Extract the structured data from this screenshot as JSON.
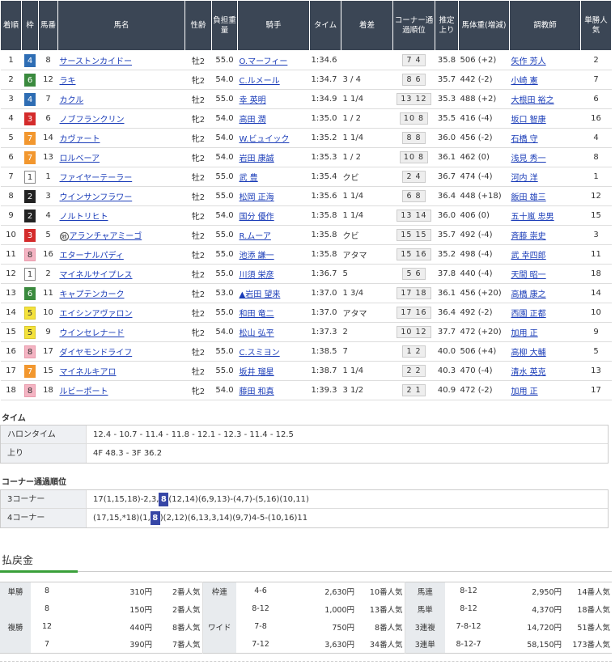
{
  "headers": [
    "着順",
    "枠",
    "馬番",
    "馬名",
    "性齢",
    "負担重量",
    "騎手",
    "タイム",
    "着差",
    "コーナー通過順位",
    "推定上り",
    "馬体重(増減)",
    "調教師",
    "単勝人気"
  ],
  "rows": [
    {
      "pos": "1",
      "waku": "4",
      "num": "8",
      "horse": "サーストンカイドー",
      "sex": "牡2",
      "wt": "55.0",
      "jockey": "O.マーフィー",
      "time": "1:34.6",
      "margin": "",
      "corner": "7 4",
      "up": "35.8",
      "bw": "506 (+2)",
      "trainer": "矢作 芳人",
      "pop": "2",
      "mark": ""
    },
    {
      "pos": "2",
      "waku": "6",
      "num": "12",
      "horse": "ラキ",
      "sex": "牝2",
      "wt": "54.0",
      "jockey": "C.ルメール",
      "time": "1:34.7",
      "margin": "3 / 4",
      "corner": "8 6",
      "up": "35.7",
      "bw": "442 (-2)",
      "trainer": "小崎 憲",
      "pop": "7",
      "mark": ""
    },
    {
      "pos": "3",
      "waku": "4",
      "num": "7",
      "horse": "カクル",
      "sex": "牡2",
      "wt": "55.0",
      "jockey": "幸 英明",
      "time": "1:34.9",
      "margin": "1 1/4",
      "corner": "13 12",
      "up": "35.3",
      "bw": "488 (+2)",
      "trainer": "大根田 裕之",
      "pop": "6",
      "mark": ""
    },
    {
      "pos": "4",
      "waku": "3",
      "num": "6",
      "horse": "ノブフランクリン",
      "sex": "牝2",
      "wt": "54.0",
      "jockey": "高田 潤",
      "time": "1:35.0",
      "margin": "1 / 2",
      "corner": "10 8",
      "up": "35.5",
      "bw": "416 (-4)",
      "trainer": "坂口 智康",
      "pop": "16",
      "mark": ""
    },
    {
      "pos": "5",
      "waku": "7",
      "num": "14",
      "horse": "カヴァート",
      "sex": "牝2",
      "wt": "54.0",
      "jockey": "W.ビュイック",
      "time": "1:35.2",
      "margin": "1 1/4",
      "corner": "8 8",
      "up": "36.0",
      "bw": "456 (-2)",
      "trainer": "石橋 守",
      "pop": "4",
      "mark": ""
    },
    {
      "pos": "6",
      "waku": "7",
      "num": "13",
      "horse": "ロルベーア",
      "sex": "牝2",
      "wt": "54.0",
      "jockey": "岩田 康誠",
      "time": "1:35.3",
      "margin": "1 / 2",
      "corner": "10 8",
      "up": "36.1",
      "bw": "462 (0)",
      "trainer": "浅見 秀一",
      "pop": "8",
      "mark": ""
    },
    {
      "pos": "7",
      "waku": "1",
      "num": "1",
      "horse": "ファイヤーテーラー",
      "sex": "牡2",
      "wt": "55.0",
      "jockey": "武 豊",
      "time": "1:35.4",
      "margin": "クビ",
      "corner": "2 4",
      "up": "36.7",
      "bw": "474 (-4)",
      "trainer": "河内 洋",
      "pop": "1",
      "mark": ""
    },
    {
      "pos": "8",
      "waku": "2",
      "num": "3",
      "horse": "ウインサンフラワー",
      "sex": "牡2",
      "wt": "55.0",
      "jockey": "松岡 正海",
      "time": "1:35.6",
      "margin": "1 1/4",
      "corner": "6 8",
      "up": "36.4",
      "bw": "448 (+18)",
      "trainer": "飯田 雄三",
      "pop": "12",
      "mark": ""
    },
    {
      "pos": "9",
      "waku": "2",
      "num": "4",
      "horse": "ノルトリヒト",
      "sex": "牝2",
      "wt": "54.0",
      "jockey": "国分 優作",
      "time": "1:35.8",
      "margin": "1 1/4",
      "corner": "13 14",
      "up": "36.0",
      "bw": "406 (0)",
      "trainer": "五十嵐 忠男",
      "pop": "15",
      "mark": ""
    },
    {
      "pos": "10",
      "waku": "3",
      "num": "5",
      "horse": "アランチャアミーゴ",
      "sex": "牡2",
      "wt": "55.0",
      "jockey": "R.ムーア",
      "time": "1:35.8",
      "margin": "クビ",
      "corner": "15 15",
      "up": "35.7",
      "bw": "492 (-4)",
      "trainer": "斉藤 崇史",
      "pop": "3",
      "mark": "地"
    },
    {
      "pos": "11",
      "waku": "8",
      "num": "16",
      "horse": "エターナルパディ",
      "sex": "牡2",
      "wt": "55.0",
      "jockey": "池添 謙一",
      "time": "1:35.8",
      "margin": "アタマ",
      "corner": "15 16",
      "up": "35.2",
      "bw": "498 (-4)",
      "trainer": "武 幸四郎",
      "pop": "11",
      "mark": ""
    },
    {
      "pos": "12",
      "waku": "1",
      "num": "2",
      "horse": "マイネルサイプレス",
      "sex": "牡2",
      "wt": "55.0",
      "jockey": "川須 栄彦",
      "time": "1:36.7",
      "margin": "5",
      "corner": "5 6",
      "up": "37.8",
      "bw": "440 (-4)",
      "trainer": "天間 昭一",
      "pop": "18",
      "mark": ""
    },
    {
      "pos": "13",
      "waku": "6",
      "num": "11",
      "horse": "キャプテンカーク",
      "sex": "牡2",
      "wt": "53.0",
      "jockey": "▲岩田 望来",
      "time": "1:37.0",
      "margin": "1 3/4",
      "corner": "17 18",
      "up": "36.1",
      "bw": "456 (+20)",
      "trainer": "高橋 康之",
      "pop": "14",
      "mark": ""
    },
    {
      "pos": "14",
      "waku": "5",
      "num": "10",
      "horse": "エイシンアヴァロン",
      "sex": "牡2",
      "wt": "55.0",
      "jockey": "和田 竜二",
      "time": "1:37.0",
      "margin": "アタマ",
      "corner": "17 16",
      "up": "36.4",
      "bw": "492 (-2)",
      "trainer": "西園 正都",
      "pop": "10",
      "mark": ""
    },
    {
      "pos": "15",
      "waku": "5",
      "num": "9",
      "horse": "ウインセレナード",
      "sex": "牝2",
      "wt": "54.0",
      "jockey": "松山 弘平",
      "time": "1:37.3",
      "margin": "2",
      "corner": "10 12",
      "up": "37.7",
      "bw": "472 (+20)",
      "trainer": "加用 正",
      "pop": "9",
      "mark": ""
    },
    {
      "pos": "16",
      "waku": "8",
      "num": "17",
      "horse": "ダイヤモンドライフ",
      "sex": "牡2",
      "wt": "55.0",
      "jockey": "C.スミヨン",
      "time": "1:38.5",
      "margin": "7",
      "corner": "1 2",
      "up": "40.0",
      "bw": "506 (+4)",
      "trainer": "高柳 大輔",
      "pop": "5",
      "mark": ""
    },
    {
      "pos": "17",
      "waku": "7",
      "num": "15",
      "horse": "マイネルキアロ",
      "sex": "牡2",
      "wt": "55.0",
      "jockey": "坂井 瑠星",
      "time": "1:38.7",
      "margin": "1 1/4",
      "corner": "2 2",
      "up": "40.3",
      "bw": "470 (-4)",
      "trainer": "清水 英克",
      "pop": "13",
      "mark": ""
    },
    {
      "pos": "18",
      "waku": "8",
      "num": "18",
      "horse": "ルビーポート",
      "sex": "牝2",
      "wt": "54.0",
      "jockey": "藤田 和真",
      "time": "1:39.3",
      "margin": "3 1/2",
      "corner": "2 1",
      "up": "40.9",
      "bw": "472 (-2)",
      "trainer": "加用 正",
      "pop": "17",
      "mark": ""
    }
  ],
  "time_section": {
    "title": "タイム",
    "furlong_label": "ハロンタイム",
    "furlong_value": "12.4 - 10.7 - 11.4 - 11.8 - 12.1 - 12.3 - 11.4 - 12.5",
    "agari_label": "上り",
    "agari_value": "4F 48.3 - 3F 36.2"
  },
  "corner_section": {
    "title": "コーナー通過順位",
    "c3_label": "3コーナー",
    "c3_pre": "17(1,15,18)-2,3,",
    "c3_hl": "8",
    "c3_post": "(12,14)(6,9,13)-(4,7)-(5,16)(10,11)",
    "c4_label": "4コーナー",
    "c4_pre": "(17,15,*18)(1,",
    "c4_hl": "8",
    "c4_post": ")(2,12)(6,13,3,14)(9,7)4-5-(10,16)11"
  },
  "payout": {
    "title": "払戻金",
    "rows": [
      [
        "単勝",
        "8",
        "310円",
        "2番人気",
        "枠連",
        "4-6",
        "2,630円",
        "10番人気",
        "馬連",
        "8-12",
        "2,950円",
        "14番人気"
      ],
      [
        "",
        "8",
        "150円",
        "2番人気",
        "",
        "8-12",
        "1,000円",
        "13番人気",
        "馬単",
        "8-12",
        "4,370円",
        "18番人気"
      ],
      [
        "複勝",
        "12",
        "440円",
        "8番人気",
        "ワイド",
        "7-8",
        "750円",
        "8番人気",
        "3連複",
        "7-8-12",
        "14,720円",
        "51番人気"
      ],
      [
        "",
        "7",
        "390円",
        "7番人気",
        "",
        "7-12",
        "3,630円",
        "34番人気",
        "3連単",
        "8-12-7",
        "58,150円",
        "173番人気"
      ]
    ]
  },
  "colors": {
    "header_bg": "#3b4655",
    "link": "#1a3cb8",
    "highlight": "#3646a6",
    "accent_green": "#3aa03a"
  }
}
